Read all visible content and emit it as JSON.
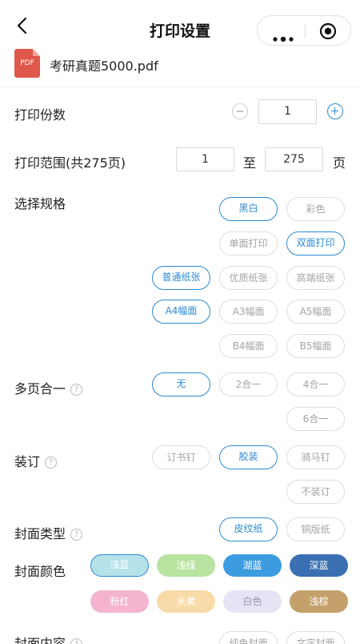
{
  "nav": {
    "title": "打印设置",
    "back_icon": "chevron-left-icon",
    "more_icon": "more-dots-icon",
    "close_icon": "target-close-icon"
  },
  "file": {
    "icon_label": "PDF",
    "name": "考研真题5000.pdf",
    "icon_color": "#e0584b"
  },
  "copies": {
    "label": "打印份数",
    "value": "1"
  },
  "range": {
    "label": "打印范围(共275页)",
    "from": "1",
    "to_word": "至",
    "to": "275",
    "unit": "页"
  },
  "spec": {
    "label": "选择规格",
    "color_options": [
      "黑白",
      "彩色"
    ],
    "side_options": [
      "单面打印",
      "双面打印"
    ],
    "paper_options": [
      "普通纸张",
      "优质纸张",
      "高端纸张"
    ],
    "size_options": [
      "A4幅面",
      "A3幅面",
      "A5幅面",
      "B4幅面",
      "B5幅面"
    ]
  },
  "multi": {
    "label": "多页合一",
    "help": "?",
    "options": [
      "无",
      "2合一",
      "4合一",
      "6合一"
    ]
  },
  "binding": {
    "label": "装订",
    "help": "?",
    "options": [
      "订书钉",
      "胶装",
      "骑马钉",
      "不装订"
    ]
  },
  "cover_type": {
    "label": "封面类型",
    "help": "?",
    "options": [
      "皮纹纸",
      "铜版纸"
    ]
  },
  "cover_color": {
    "label": "封面颜色",
    "options": [
      "浅蓝",
      "浅绿",
      "湖蓝",
      "深蓝",
      "粉红",
      "米黄",
      "白色",
      "浅棕"
    ],
    "colors": [
      "#b5e2ea",
      "#b9e3a0",
      "#3d9ce0",
      "#3a6fb2",
      "#f4b4cf",
      "#f8dba8",
      "#e4e4f4",
      "#c4a06a"
    ]
  },
  "cover_content": {
    "label": "封面内容",
    "help": "?",
    "options": [
      "纯色封面",
      "文字封面"
    ]
  },
  "accent": "#2d8ad1"
}
